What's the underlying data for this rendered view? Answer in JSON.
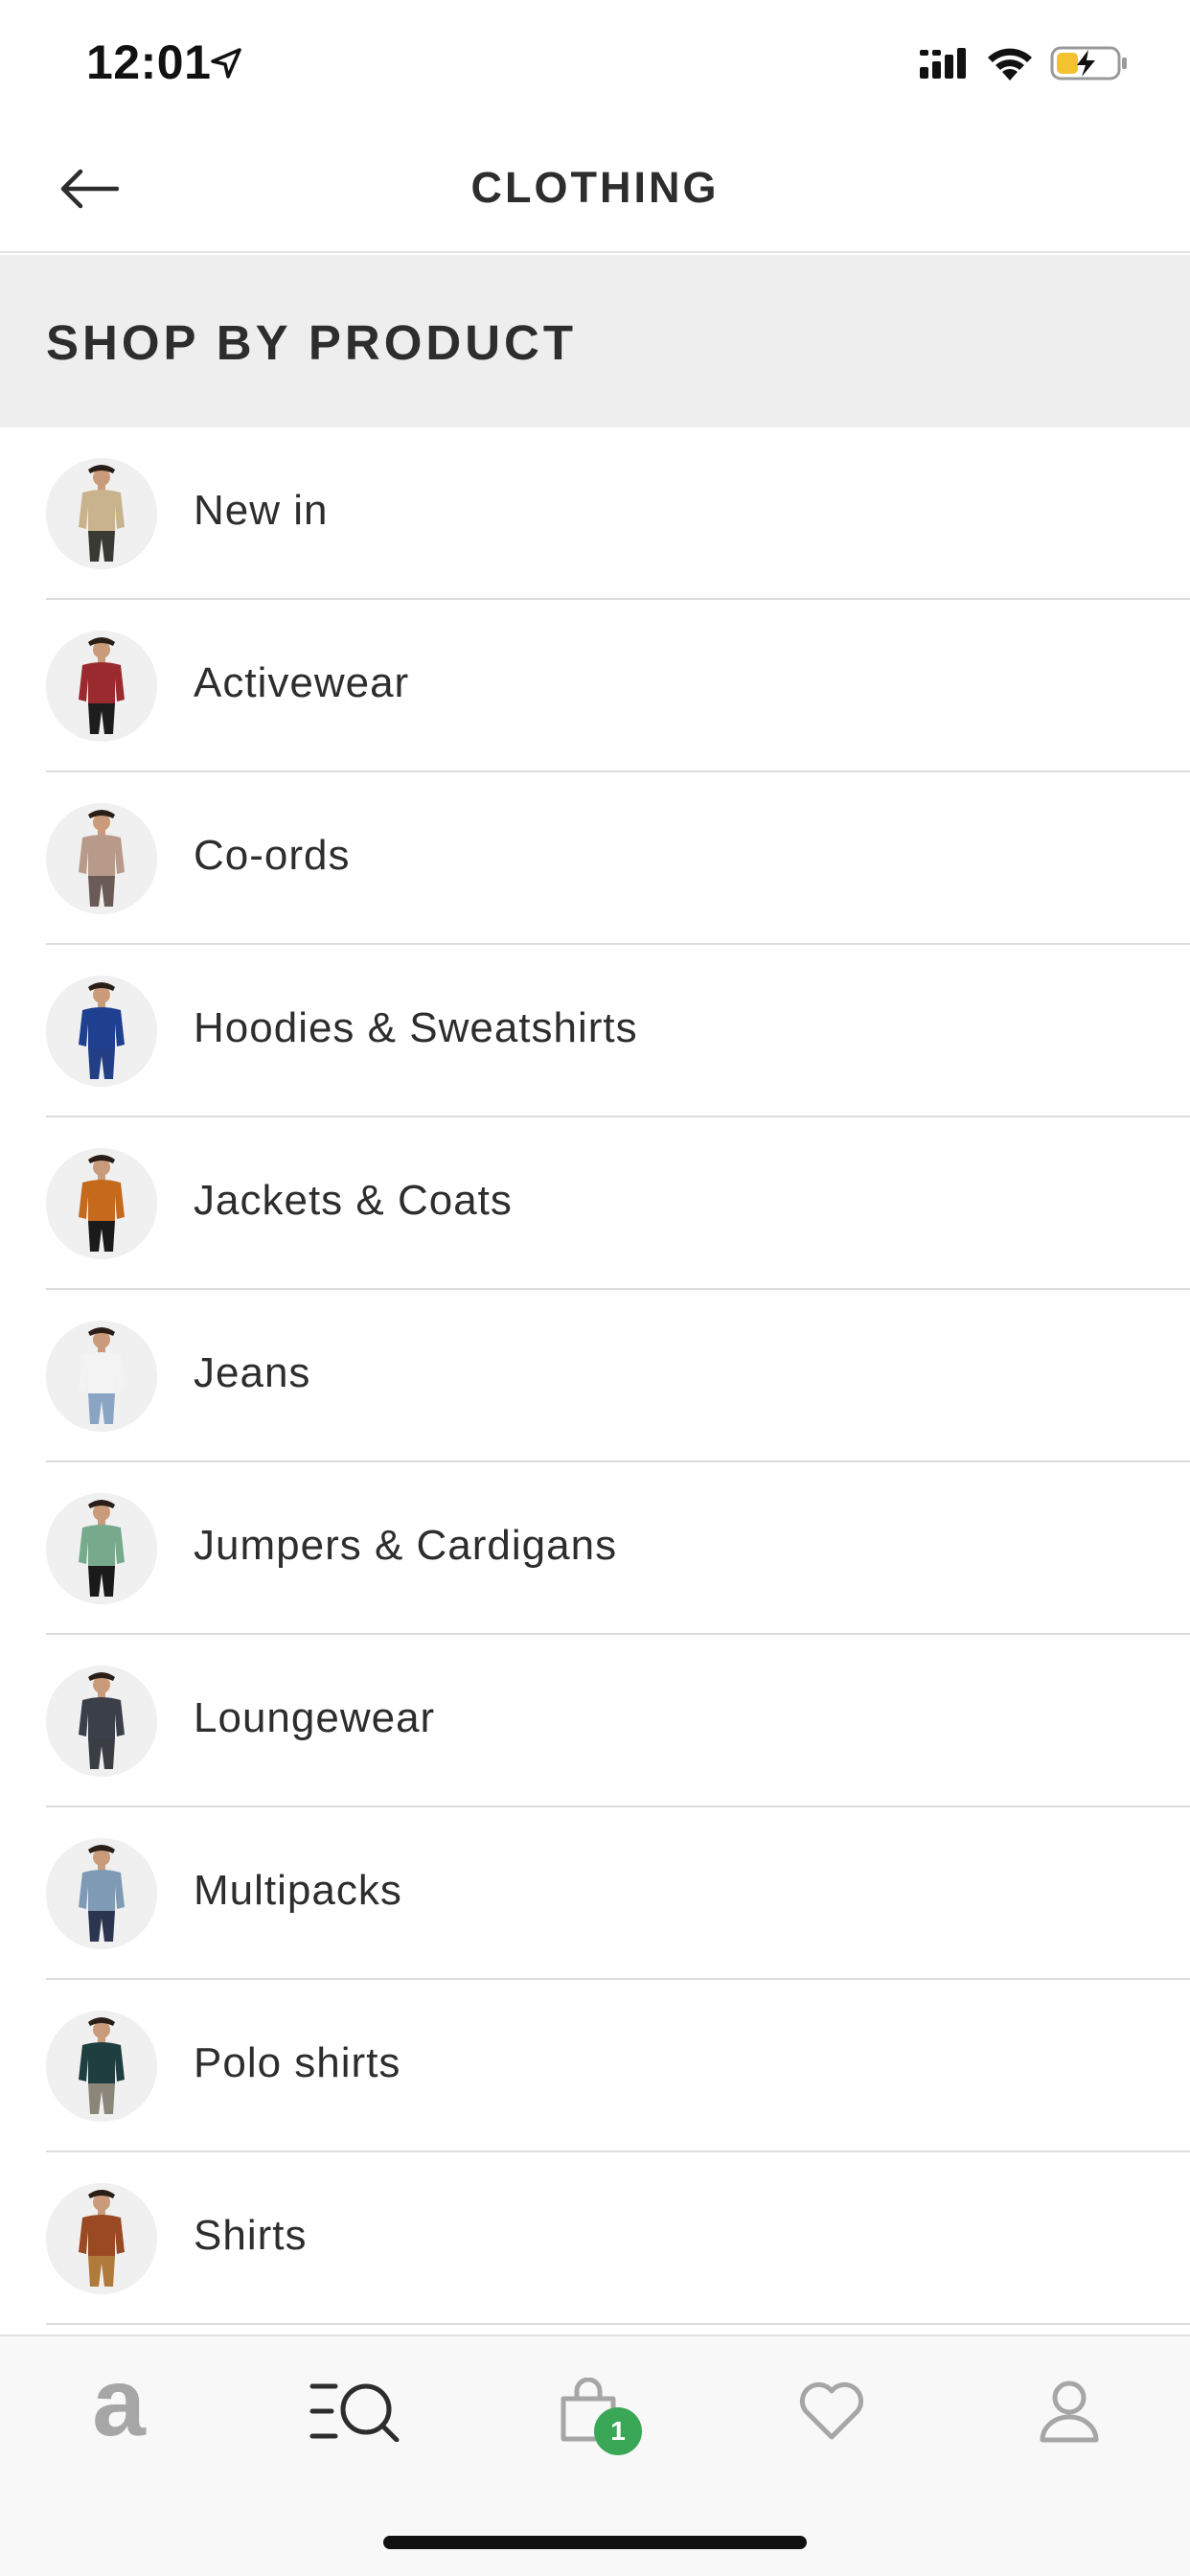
{
  "status_bar": {
    "time": "12:01"
  },
  "header": {
    "title": "CLOTHING"
  },
  "section": {
    "title": "SHOP BY PRODUCT"
  },
  "items": [
    {
      "label": "New in",
      "shirt": "#c9b38c",
      "pants": "#3a3a34"
    },
    {
      "label": "Activewear",
      "shirt": "#9a2a2e",
      "pants": "#1d1d1d"
    },
    {
      "label": "Co-ords",
      "shirt": "#b79a8a",
      "pants": "#6b5b56"
    },
    {
      "label": "Hoodies & Sweatshirts",
      "shirt": "#1f3f8f",
      "pants": "#223f86"
    },
    {
      "label": "Jackets & Coats",
      "shirt": "#c56a1d",
      "pants": "#1a1a1a"
    },
    {
      "label": "Jeans",
      "shirt": "#f3f3f3",
      "pants": "#8aa5c4"
    },
    {
      "label": "Jumpers & Cardigans",
      "shirt": "#77a98c",
      "pants": "#1a1a1a"
    },
    {
      "label": "Loungewear",
      "shirt": "#3b3f4a",
      "pants": "#3a3d44"
    },
    {
      "label": "Multipacks",
      "shirt": "#7f9ab5",
      "pants": "#2b3550"
    },
    {
      "label": "Polo shirts",
      "shirt": "#1f3e3f",
      "pants": "#8b857a"
    },
    {
      "label": "Shirts",
      "shirt": "#9a4a22",
      "pants": "#b07a3a"
    }
  ],
  "tab_bar": {
    "home_icon": "brand-a-icon",
    "home_glyph": "a",
    "search_icon": "search-menu-icon",
    "bag_icon": "bag-icon",
    "bag_count": "1",
    "saved_icon": "heart-icon",
    "account_icon": "person-icon"
  },
  "colors": {
    "badge": "#3aa757",
    "section_bg": "#eeeeee",
    "text": "#2d2d2d",
    "icon_gray": "#a6a6a6"
  }
}
